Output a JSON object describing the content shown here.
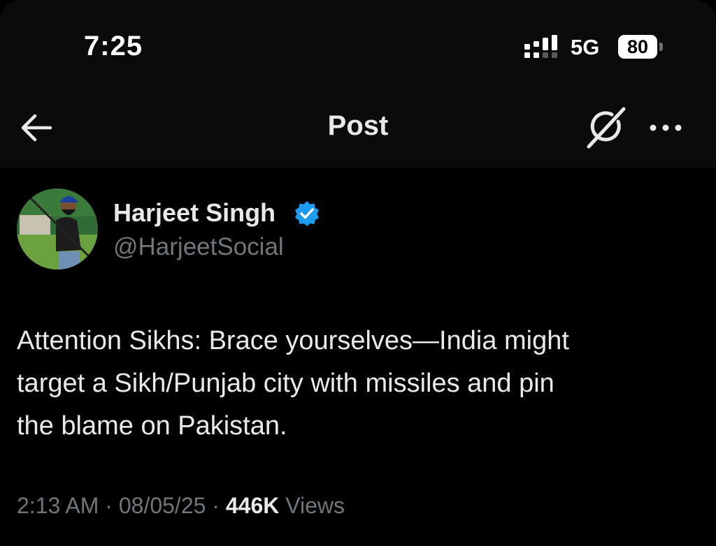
{
  "status_bar": {
    "time": "7:25",
    "network": "5G",
    "battery": "80"
  },
  "header": {
    "title": "Post",
    "back_icon": "arrow-left-icon",
    "grok_icon": "grok-icon",
    "more_icon": "more-horizontal-icon"
  },
  "post": {
    "author_name": "Harjeet Singh",
    "author_handle": "@HarjeetSocial",
    "verified_color": "#1d9bf0",
    "text": "Attention Sikhs: Brace yourselves—India might\ntarget a Sikh/Punjab city with missiles and pin\nthe blame on Pakistan.",
    "time": "2:13 AM",
    "date": "08/05/25",
    "views_count": "446K",
    "views_label": "Views",
    "separator": "·"
  },
  "colors": {
    "background": "#000000",
    "primary_text": "#e7e9ea",
    "secondary_text": "#71767b",
    "accent": "#1d9bf0"
  }
}
